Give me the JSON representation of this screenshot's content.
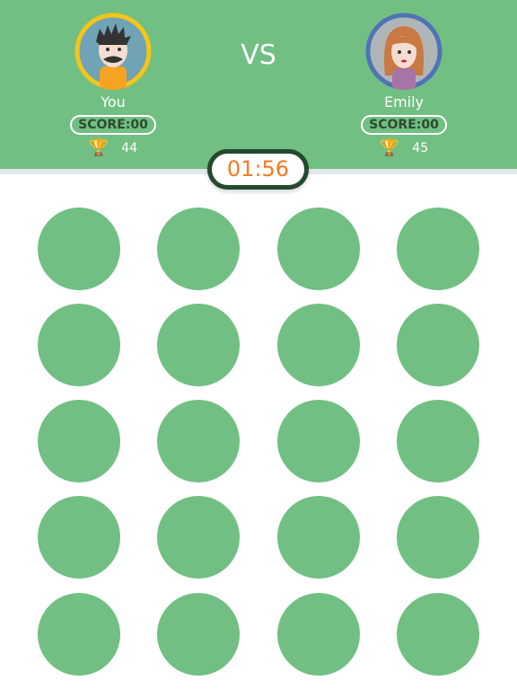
{
  "players": [
    {
      "name": "You",
      "score": "SCORE:00",
      "trophies": "44",
      "ring_color": "#f5c518"
    },
    {
      "name": "Emily",
      "score": "SCORE:00",
      "trophies": "45",
      "ring_color": "#4f73b7"
    }
  ],
  "vs": "VS",
  "timer": "01:56",
  "board": {
    "rows": 5,
    "cols": 4,
    "tile_color": "#72bf83"
  },
  "colors": {
    "header": "#72bf83",
    "timer_text": "#f47a20",
    "timer_border": "#244a2e"
  }
}
